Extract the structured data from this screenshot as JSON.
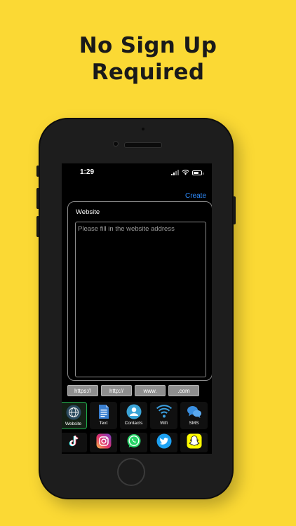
{
  "headline": {
    "line1": "No Sign Up",
    "line2": "Required"
  },
  "status_bar": {
    "time": "1:29"
  },
  "header": {
    "create_label": "Create"
  },
  "form": {
    "title": "Website",
    "placeholder": "Please fill in the website address",
    "value": ""
  },
  "shortcuts": [
    "https://",
    "http://",
    "www.",
    ".com"
  ],
  "types": [
    {
      "label": "Website",
      "icon": "globe-icon",
      "active": true
    },
    {
      "label": "Text",
      "icon": "document-icon",
      "active": false
    },
    {
      "label": "Contacts",
      "icon": "contact-icon",
      "active": false
    },
    {
      "label": "Wifi",
      "icon": "wifi-icon",
      "active": false
    },
    {
      "label": "SMS",
      "icon": "chat-bubbles-icon",
      "active": false
    }
  ],
  "social": [
    {
      "icon": "tiktok-icon"
    },
    {
      "icon": "instagram-icon"
    },
    {
      "icon": "whatsapp-icon"
    },
    {
      "icon": "twitter-icon"
    },
    {
      "icon": "snapchat-icon"
    }
  ],
  "colors": {
    "background": "#fbd934",
    "accent": "#2e8cff",
    "active_border": "#1faa4a"
  }
}
